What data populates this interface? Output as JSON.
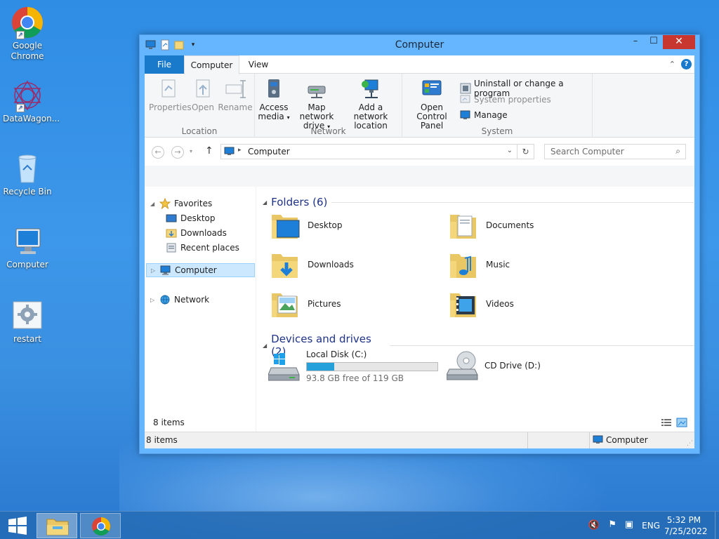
{
  "desktop": {
    "icons": [
      {
        "label": "Google\nChrome",
        "line1": "Google",
        "line2": "Chrome"
      },
      {
        "line1": "DataWagon...",
        "line2": ""
      },
      {
        "line1": "Recycle Bin",
        "line2": ""
      },
      {
        "line1": "Computer",
        "line2": ""
      },
      {
        "line1": "restart",
        "line2": ""
      }
    ]
  },
  "window": {
    "title": "Computer",
    "tabs": {
      "file": "File",
      "computer": "Computer",
      "view": "View"
    },
    "ribbon": {
      "location": {
        "label": "Location",
        "properties": "Properties",
        "open": "Open",
        "rename": "Rename"
      },
      "network": {
        "label": "Network",
        "access_media_1": "Access",
        "access_media_2": "media",
        "map_drive_1": "Map network",
        "map_drive_2": "drive",
        "add_location_1": "Add a network",
        "add_location_2": "location"
      },
      "system": {
        "label": "System",
        "open_cp_1": "Open Control",
        "open_cp_2": "Panel",
        "uninstall": "Uninstall or change a program",
        "system_properties": "System properties",
        "manage": "Manage"
      }
    },
    "address": {
      "path": "Computer"
    },
    "search": {
      "placeholder": "Search Computer"
    },
    "nav": {
      "favorites": "Favorites",
      "desktop": "Desktop",
      "downloads": "Downloads",
      "recent": "Recent places",
      "computer": "Computer",
      "network": "Network"
    },
    "folders": {
      "header": "Folders (6)",
      "items": [
        "Desktop",
        "Documents",
        "Downloads",
        "Music",
        "Pictures",
        "Videos"
      ]
    },
    "devices": {
      "header": "Devices and drives (2)",
      "local_disk": {
        "name": "Local Disk (C:)",
        "free_text": "93.8 GB free of 119 GB",
        "used_fraction": 0.212
      },
      "cd_drive": {
        "name": "CD Drive (D:)"
      }
    },
    "items_count_inner": "8 items",
    "status": {
      "left": "8 items",
      "right": "Computer"
    }
  },
  "taskbar": {
    "language": "ENG",
    "time": "5:32 PM",
    "date": "7/25/2022"
  },
  "colors": {
    "accent": "#1979ca",
    "close": "#c7372f",
    "drive_fill": "#26a0da",
    "section_header": "#1e3287"
  }
}
